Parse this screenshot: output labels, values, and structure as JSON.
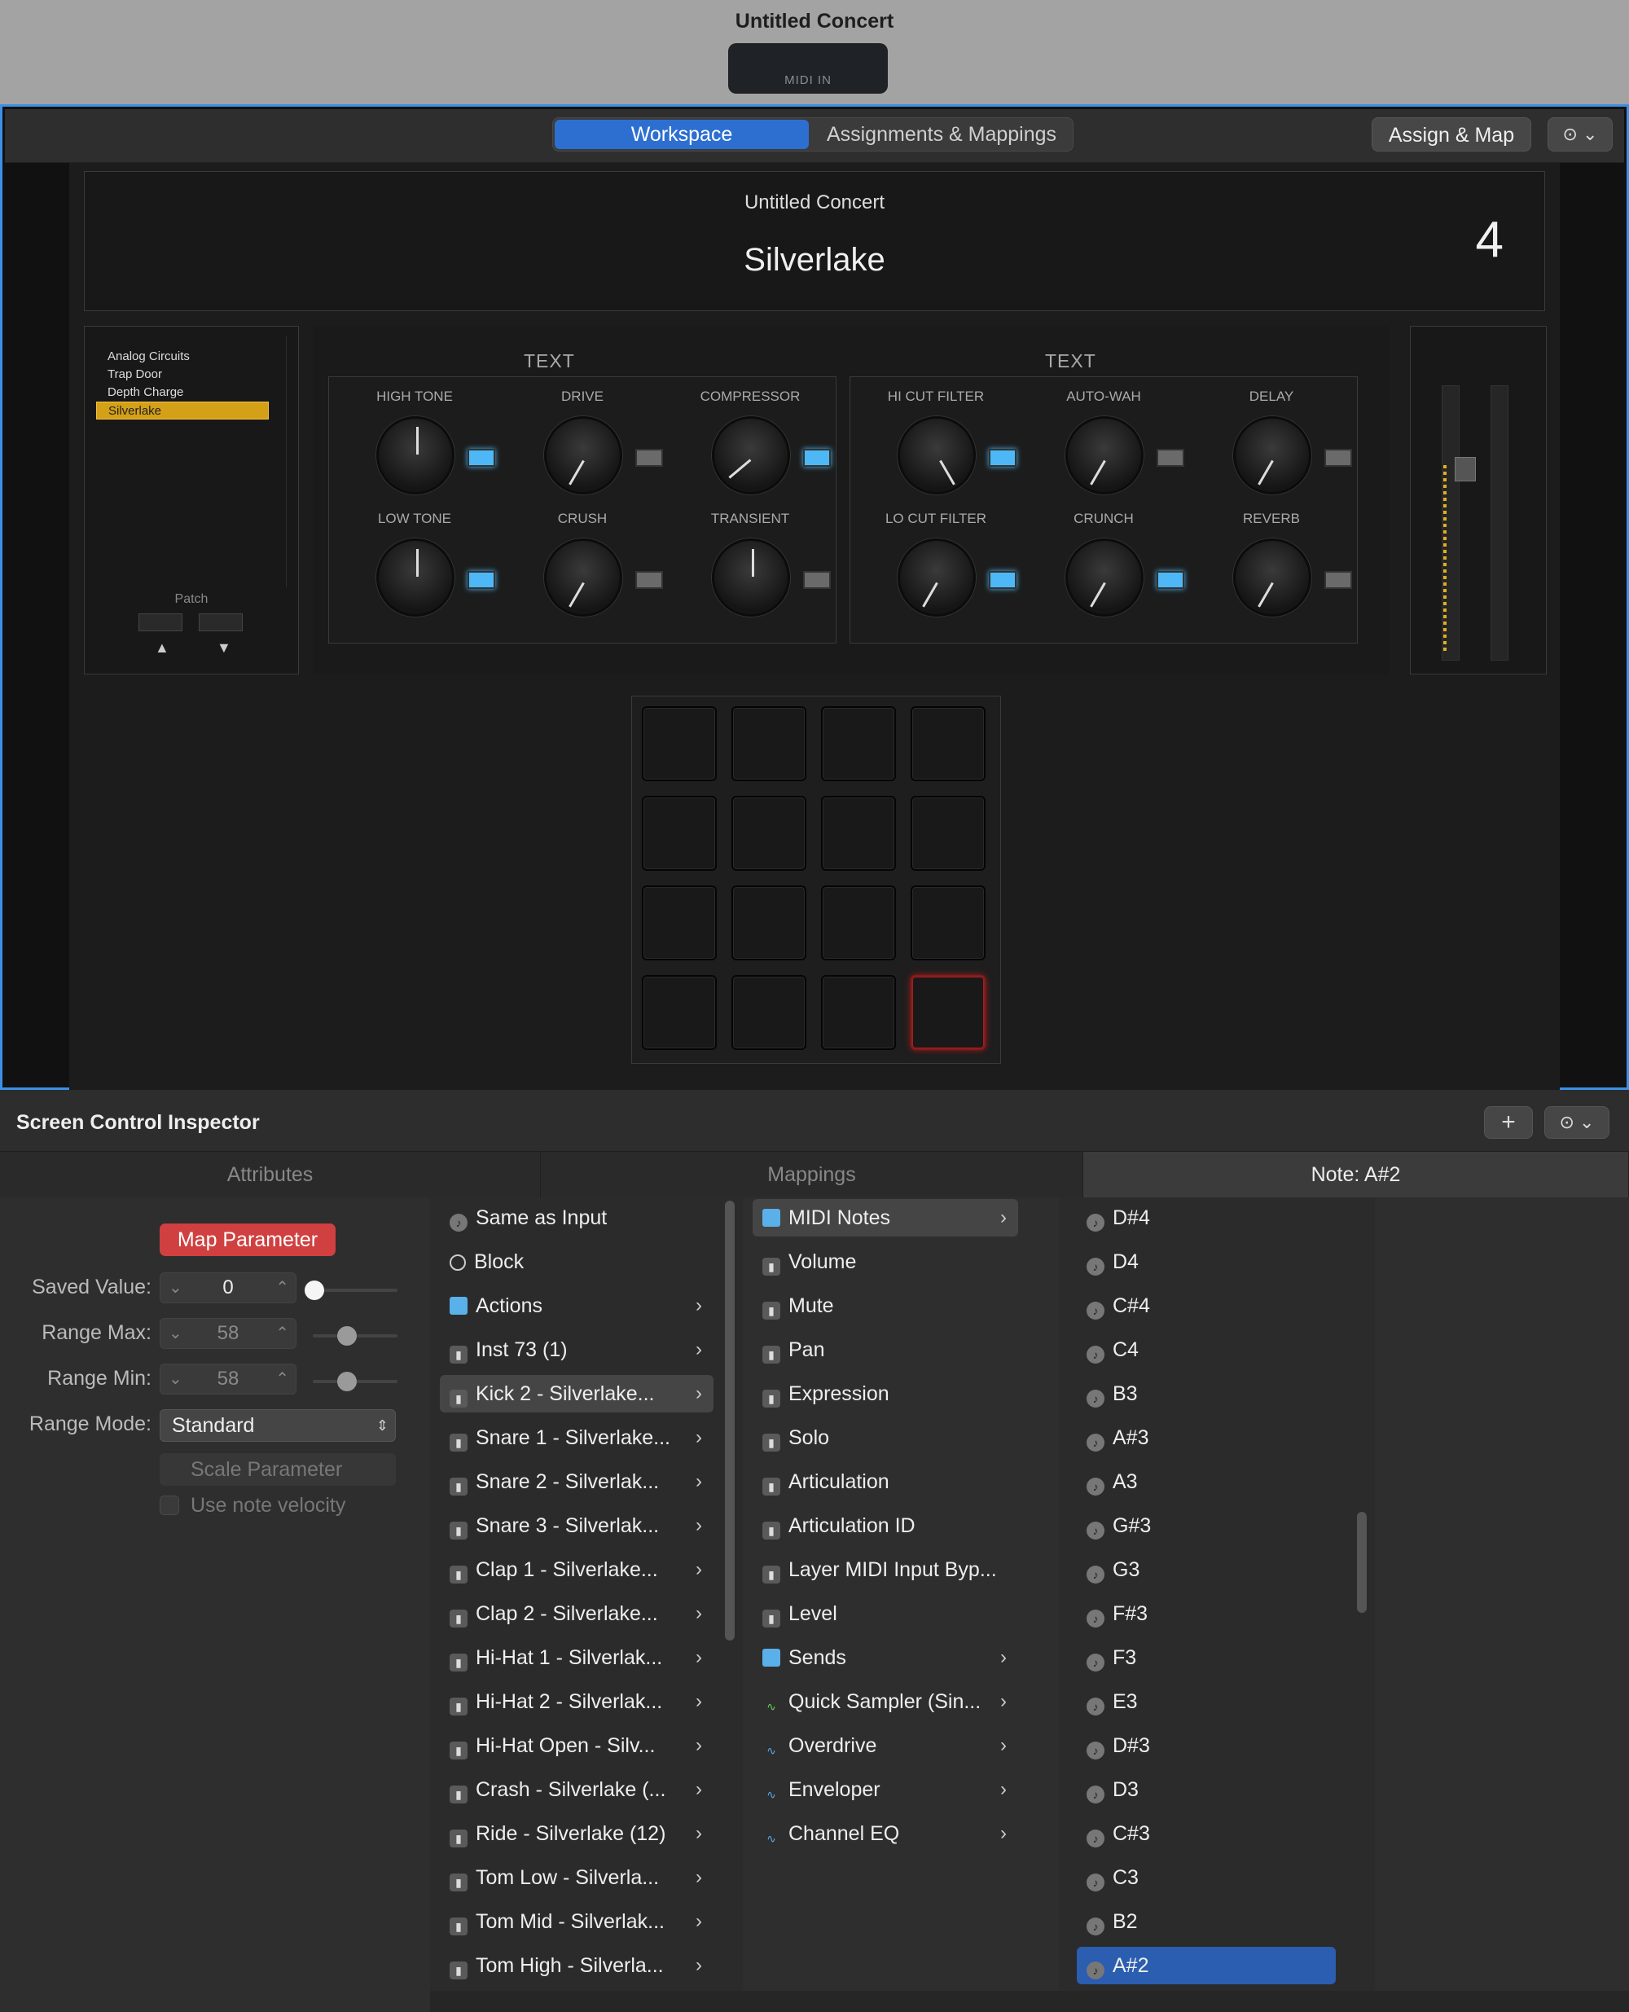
{
  "window": {
    "title": "Untitled Concert",
    "midi_in": "MIDI IN"
  },
  "toolbar": {
    "tabs": [
      "Workspace",
      "Assignments & Mappings"
    ],
    "assign_map": "Assign & Map",
    "more": "⊙ ⌄"
  },
  "header": {
    "concert": "Untitled Concert",
    "patch": "Silverlake",
    "number": "4"
  },
  "patches": {
    "items": [
      "Analog Circuits",
      "Trap Door",
      "Depth Charge",
      "Silverlake"
    ],
    "selected": "Silverlake",
    "label": "Patch",
    "up": "▲",
    "down": "▼"
  },
  "fx": {
    "group1_title": "TEXT",
    "group2_title": "TEXT",
    "group1": [
      {
        "label": "HIGH TONE",
        "on": true
      },
      {
        "label": "DRIVE",
        "on": false
      },
      {
        "label": "COMPRESSOR",
        "on": true
      },
      {
        "label": "LOW TONE",
        "on": true
      },
      {
        "label": "CRUSH",
        "on": false
      },
      {
        "label": "TRANSIENT",
        "on": false
      }
    ],
    "group2": [
      {
        "label": "HI CUT FILTER",
        "on": true
      },
      {
        "label": "AUTO-WAH",
        "on": false
      },
      {
        "label": "DELAY",
        "on": false
      },
      {
        "label": "LO CUT FILTER",
        "on": true
      },
      {
        "label": "CRUNCH",
        "on": true
      },
      {
        "label": "REVERB",
        "on": false
      }
    ]
  },
  "inspector": {
    "title": "Screen Control Inspector",
    "plus": "+",
    "more": "⊙ ⌄",
    "tabs": [
      "Attributes",
      "Mappings",
      "Note: A#2"
    ],
    "map_parameter": "Map Parameter",
    "saved_value_label": "Saved Value:",
    "saved_value": "0",
    "range_max_label": "Range Max:",
    "range_max": "58",
    "range_min_label": "Range Min:",
    "range_min": "58",
    "range_mode_label": "Range Mode:",
    "range_mode": "Standard",
    "scale_parameter": "Scale Parameter",
    "use_note_velocity": "Use note velocity"
  },
  "col1": [
    {
      "label": "Same as Input",
      "icon": "note",
      "chev": false
    },
    {
      "label": "Block",
      "icon": "none",
      "chev": false
    },
    {
      "label": "Actions",
      "icon": "folder",
      "chev": true
    },
    {
      "label": "Inst 73 (1)",
      "icon": "plug",
      "chev": true
    },
    {
      "label": "Kick 2 - Silverlake...",
      "icon": "plug",
      "chev": true,
      "sel": true
    },
    {
      "label": "Snare 1 - Silverlake...",
      "icon": "plug",
      "chev": true
    },
    {
      "label": "Snare 2 - Silverlak...",
      "icon": "plug",
      "chev": true
    },
    {
      "label": "Snare 3 - Silverlak...",
      "icon": "plug",
      "chev": true
    },
    {
      "label": "Clap 1 - Silverlake...",
      "icon": "plug",
      "chev": true
    },
    {
      "label": "Clap 2 - Silverlake...",
      "icon": "plug",
      "chev": true
    },
    {
      "label": "Hi-Hat 1 - Silverlak...",
      "icon": "plug",
      "chev": true
    },
    {
      "label": "Hi-Hat 2 - Silverlak...",
      "icon": "plug",
      "chev": true
    },
    {
      "label": "Hi-Hat Open - Silv...",
      "icon": "plug",
      "chev": true
    },
    {
      "label": "Crash - Silverlake (...",
      "icon": "plug",
      "chev": true
    },
    {
      "label": "Ride - Silverlake (12)",
      "icon": "plug",
      "chev": true
    },
    {
      "label": "Tom Low - Silverla...",
      "icon": "plug",
      "chev": true
    },
    {
      "label": "Tom Mid - Silverlak...",
      "icon": "plug",
      "chev": true
    },
    {
      "label": "Tom High - Silverla...",
      "icon": "plug",
      "chev": true
    }
  ],
  "col2": [
    {
      "label": "MIDI Notes",
      "icon": "folder",
      "chev": true,
      "sel": true
    },
    {
      "label": "Volume",
      "icon": "plug",
      "chev": false
    },
    {
      "label": "Mute",
      "icon": "plug",
      "chev": false
    },
    {
      "label": "Pan",
      "icon": "plug",
      "chev": false
    },
    {
      "label": "Expression",
      "icon": "plug",
      "chev": false
    },
    {
      "label": "Solo",
      "icon": "plug",
      "chev": false
    },
    {
      "label": "Articulation",
      "icon": "plug",
      "chev": false
    },
    {
      "label": "Articulation ID",
      "icon": "plug",
      "chev": false
    },
    {
      "label": "Layer MIDI Input Byp...",
      "icon": "plug",
      "chev": false
    },
    {
      "label": "Level",
      "icon": "plug",
      "chev": false
    },
    {
      "label": "Sends",
      "icon": "folder",
      "chev": true
    },
    {
      "label": "Quick Sampler (Sin...",
      "icon": "wave",
      "chev": true
    },
    {
      "label": "Overdrive",
      "icon": "wave",
      "chev": true
    },
    {
      "label": "Enveloper",
      "icon": "wave",
      "chev": true
    },
    {
      "label": "Channel EQ",
      "icon": "wave",
      "chev": true
    }
  ],
  "col3": [
    "D#4",
    "D4",
    "C#4",
    "C4",
    "B3",
    "A#3",
    "A3",
    "G#3",
    "G3",
    "F#3",
    "F3",
    "E3",
    "D#3",
    "D3",
    "C#3",
    "C3",
    "B2",
    "A#2"
  ],
  "col3_selected": "A#2",
  "colors": {
    "accent": "#2d6fd1",
    "led_on": "#4db8f5",
    "map_button": "#d04040",
    "patch_selected": "#d4a017"
  }
}
